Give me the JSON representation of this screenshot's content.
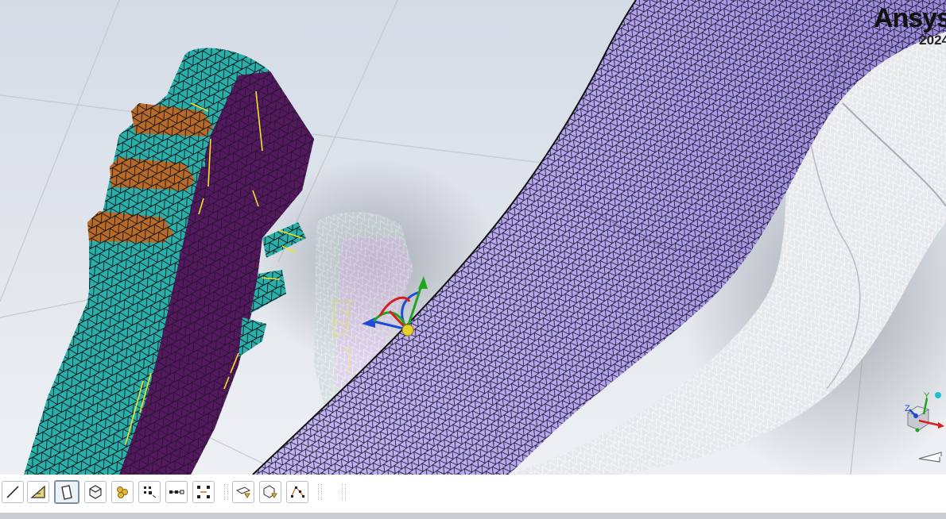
{
  "brand": {
    "name": "Ansys",
    "version": "2024"
  },
  "colors": {
    "background": "#dfe4ec",
    "teal_mesh": "#26b3ad",
    "orange_face": "#b86a26",
    "dark_purple_face": "#5a1a6e",
    "lavender_surface": "#b9aaf0",
    "mesh_lines": "#111111",
    "highlight_yellow": "#f2e32a"
  },
  "toolbar": {
    "items": [
      {
        "name": "select-edge-tool",
        "icon": "edge-line-icon",
        "active": false
      },
      {
        "name": "select-face-edge-tool",
        "icon": "triangle-face-icon",
        "active": false
      },
      {
        "name": "select-face-tool",
        "icon": "face-quad-icon",
        "active": true
      },
      {
        "name": "select-body-tool",
        "icon": "cube-icon",
        "active": false
      },
      {
        "name": "select-zone-tool",
        "icon": "cells-icon",
        "active": false
      },
      {
        "name": "select-nodes-tool",
        "icon": "node-points-icon",
        "active": false
      },
      {
        "name": "select-path-tool",
        "icon": "node-path-icon",
        "active": false
      },
      {
        "name": "select-node-group-tool",
        "icon": "node-group-icon",
        "active": false
      },
      {
        "name": "face-filter-tool",
        "icon": "face-filter-icon",
        "active": false
      },
      {
        "name": "body-filter-tool",
        "icon": "body-filter-icon",
        "active": false
      },
      {
        "name": "polyline-select-tool",
        "icon": "polyline-icon",
        "active": false
      }
    ]
  },
  "triad": {
    "axes": [
      "X",
      "Y",
      "Z"
    ]
  }
}
